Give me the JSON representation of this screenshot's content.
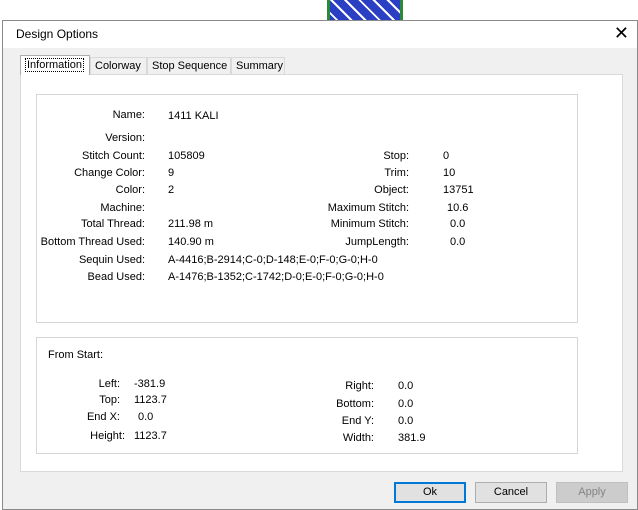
{
  "window": {
    "title": "Design Options",
    "close_glyph": "✕"
  },
  "tabs": [
    {
      "label": "Information",
      "active": true
    },
    {
      "label": "Colorway",
      "active": false
    },
    {
      "label": "Stop Sequence",
      "active": false
    },
    {
      "label": "Summary",
      "active": false
    }
  ],
  "info": {
    "name_label": "Name:",
    "name_value": "1411 KALI",
    "version_label": "Version:",
    "version_value": "",
    "stitch_count_label": "Stitch Count:",
    "stitch_count_value": "105809",
    "change_color_label": "Change Color:",
    "change_color_value": "9",
    "color_label": "Color:",
    "color_value": "2",
    "machine_label": "Machine:",
    "machine_value": "",
    "total_thread_label": "Total Thread:",
    "total_thread_value": "211.98 m",
    "bottom_thread_label": "Bottom Thread Used:",
    "bottom_thread_value": "140.90 m",
    "sequin_label": "Sequin Used:",
    "sequin_value": "A-4416;B-2914;C-0;D-148;E-0;F-0;G-0;H-0",
    "bead_label": "Bead Used:",
    "bead_value": "A-1476;B-1352;C-1742;D-0;E-0;F-0;G-0;H-0",
    "stop_label": "Stop:",
    "stop_value": "0",
    "trim_label": "Trim:",
    "trim_value": "10",
    "object_label": "Object:",
    "object_value": "13751",
    "max_stitch_label": "Maximum Stitch:",
    "max_stitch_value": "10.6",
    "min_stitch_label": "Minimum Stitch:",
    "min_stitch_value": "0.0",
    "jump_length_label": "JumpLength:",
    "jump_length_value": "0.0"
  },
  "from_start": {
    "heading": "From Start:",
    "left_label": "Left:",
    "left_value": "-381.9",
    "top_label": "Top:",
    "top_value": "1123.7",
    "endx_label": "End X:",
    "endx_value": "0.0",
    "height_label": "Height:",
    "height_value": "1123.7",
    "right_label": "Right:",
    "right_value": "0.0",
    "bottom_label": "Bottom:",
    "bottom_value": "0.0",
    "endy_label": "End Y:",
    "endy_value": "0.0",
    "width_label": "Width:",
    "width_value": "381.9"
  },
  "buttons": {
    "ok": "Ok",
    "cancel": "Cancel",
    "apply": "Apply"
  },
  "colors": {
    "accent": "#0078d7",
    "panel": "#ffffff",
    "dialog_bg": "#f0f0f0"
  }
}
